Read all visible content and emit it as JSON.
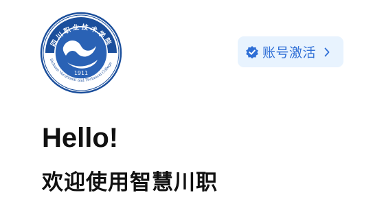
{
  "header": {
    "logo": {
      "icon": "college-seal-icon",
      "text_top": "四川职业技术学院",
      "text_bottom": "Sichuan Vocational and Technical College",
      "year": "1911",
      "colors": {
        "ring": "#1b4f9c",
        "wave": "#2a62b5",
        "inner": "#ffffff"
      }
    },
    "activate_button": {
      "icon": "verified-badge-icon",
      "label": "账号激活",
      "trailing_icon": "chevron-right-icon",
      "background": "#e8f3fe",
      "accent": "#2f6fd6"
    }
  },
  "main": {
    "greeting": "Hello!",
    "welcome": "欢迎使用智慧川职"
  }
}
